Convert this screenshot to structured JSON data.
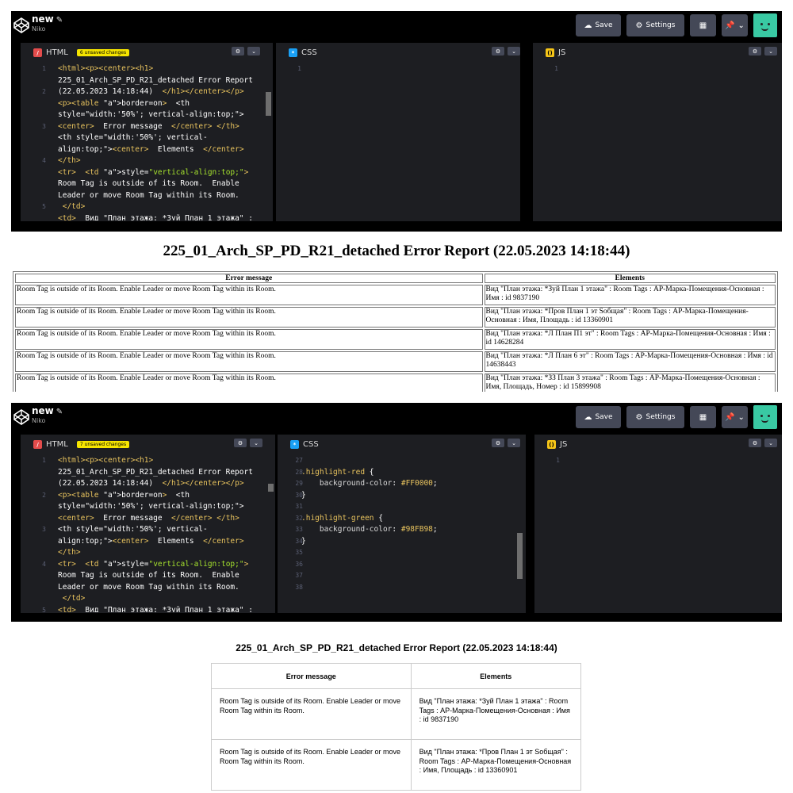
{
  "editor": {
    "project_title": "new",
    "owner": "Niko",
    "save_label": "Save",
    "settings_label": "Settings",
    "tabs": {
      "html": "HTML",
      "css": "CSS",
      "js": "JS"
    },
    "unsaved_1": "6 unsaved changes",
    "unsaved_2": "7 unsaved changes",
    "html_gutter_1": [
      "1",
      "",
      "2",
      "",
      "",
      "3",
      "",
      "",
      "4",
      "",
      "",
      "",
      "5"
    ],
    "html_gutter_2": [
      "1",
      "",
      "",
      "2",
      "",
      "",
      "3",
      "",
      "",
      "4",
      "",
      "",
      "",
      "5"
    ],
    "html_code": [
      "<html><p><center><h1>",
      "225_01_Arch_SP_PD_R21_detached Error Report",
      "(22.05.2023 14:18:44)  </h1></center></p>",
      "<p><table border=on>  <th",
      "style=\"width:'50%'; vertical-align:top;\">",
      "<center>  Error message  </center> </th>",
      "<th style=\"width:'50%'; vertical-",
      "align:top;\"><center>  Elements  </center>",
      "</th>",
      "<tr>  <td style=\"vertical-align:top;\">",
      "Room Tag is outside of its Room.  Enable",
      "Leader or move Room Tag within its Room.",
      " </td>",
      "<td>  Вид \"План этажа: *Зуй План 1 этажа\" :"
    ],
    "css_gutter": [
      "27",
      "28",
      "29",
      "30",
      "31",
      "32",
      "33",
      "34",
      "35",
      "36",
      "37",
      "38"
    ],
    "css_code": [
      "",
      ".highlight-red {",
      "    background-color: #FF0000;",
      "}",
      "",
      ".highlight-green {",
      "    background-color: #98FB98;",
      "}",
      "",
      "",
      "",
      ""
    ],
    "css_gutter_1": "1",
    "js_gutter": "1"
  },
  "report": {
    "title": "225_01_Arch_SP_PD_R21_detached Error Report (22.05.2023 14:18:44)",
    "col_error": "Error message",
    "col_elements": "Elements",
    "rows": [
      {
        "error": "Room Tag is outside of its Room. Enable Leader or move Room Tag within its Room.",
        "elements": "Вид \"План этажа: *Зуй План 1 этажа\" : Room Tags : АР-Марка-Помещения-Основная : Имя : id 9837190"
      },
      {
        "error": "Room Tag is outside of its Room. Enable Leader or move Room Tag within its Room.",
        "elements": "Вид \"План этажа: *Пров План 1 эт Sобщая\" : Room Tags : АР-Марка-Помещения-Основная : Имя, Площадь : id 13360901"
      },
      {
        "error": "Room Tag is outside of its Room. Enable Leader or move Room Tag within its Room.",
        "elements": "Вид \"План этажа: *Л План П1 эт\" : Room Tags : АР-Марка-Помещения-Основная : Имя : id 14628284"
      },
      {
        "error": "Room Tag is outside of its Room. Enable Leader or move Room Tag within its Room.",
        "elements": "Вид \"План этажа: *Л План 6 эт\" : Room Tags : АР-Марка-Помещения-Основная : Имя : id 14638443"
      },
      {
        "error": "Room Tag is outside of its Room. Enable Leader or move Room Tag within its Room.",
        "elements": "Вид \"План этажа: *ЗЗ План 3 этажа\" : Room Tags : АР-Марка-Помещения-Основная : Имя, Площадь, Номер : id 15899908"
      }
    ],
    "rows_styled": [
      {
        "error": "Room Tag is outside of its Room. Enable Leader or move Room Tag within its Room.",
        "elements": "Вид \"План этажа: *Зуй План 1 этажа\" : Room Tags : АР-Марка-Помещения-Основная : Имя : id 9837190"
      },
      {
        "error": "Room Tag is outside of its Room. Enable Leader or move Room Tag within its Room.",
        "elements": "Вид \"План этажа: *Пров План 1 эт Sобщая\" : Room Tags : АР-Марка-Помещения-Основная : Имя, Площадь : id 13360901"
      }
    ]
  }
}
